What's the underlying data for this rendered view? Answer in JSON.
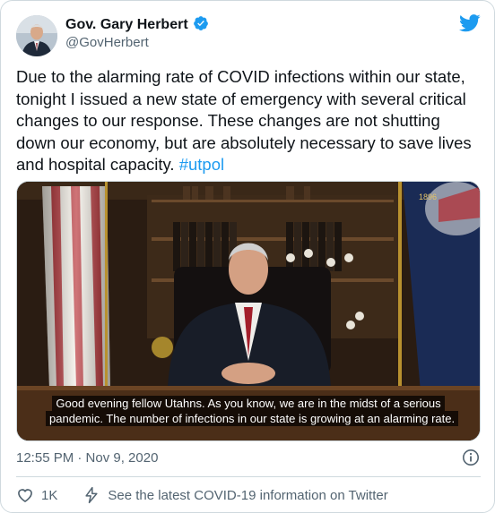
{
  "author": {
    "name": "Gov. Gary Herbert",
    "handle": "@GovHerbert",
    "verified": true
  },
  "tweet": {
    "text": "Due to the alarming rate of COVID infections within our state, tonight I issued a new state of emergency with several critical changes to our response. These changes are not shutting down our economy, but are absolutely necessary to save lives and hospital capacity. ",
    "hashtag": "#utpol"
  },
  "media": {
    "subtitle_line1": "Good evening fellow Utahns. As you know, we are in the midst of a serious",
    "subtitle_line2": "pandemic. The number of infections in our state is growing at an alarming rate.",
    "flag_year": "1896"
  },
  "footer": {
    "timestamp": "12:55 PM · Nov 9, 2020",
    "like_count": "1K",
    "covid_link": "See the latest COVID-19 information on Twitter"
  },
  "colors": {
    "link": "#1d9bf0",
    "verified": "#1d9bf0",
    "secondary_text": "#536471",
    "border": "#cfd9de"
  },
  "icons": {
    "brand": "twitter-bird-icon",
    "verified": "verified-badge-icon",
    "info": "info-icon",
    "like": "heart-icon",
    "covid": "lightning-bolt-icon"
  }
}
